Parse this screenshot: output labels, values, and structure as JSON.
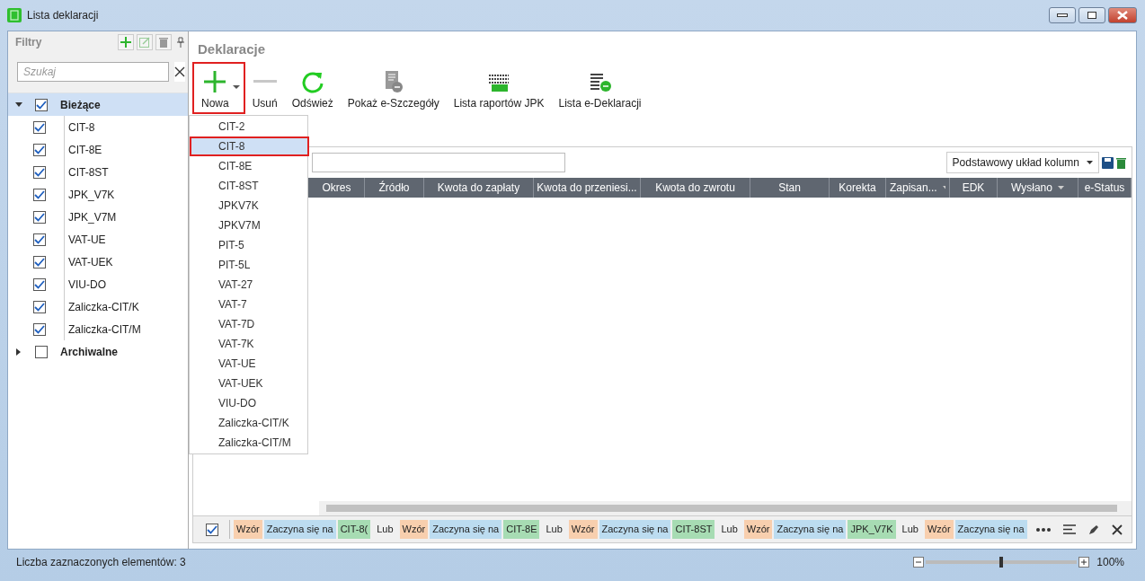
{
  "window": {
    "title": "Lista deklaracji"
  },
  "filters_panel": {
    "title": "Filtry",
    "search": {
      "placeholder": "Szukaj"
    },
    "groups": [
      {
        "label": "Bieżące",
        "checked": true,
        "expanded": true,
        "selected": true,
        "children": [
          {
            "label": "CIT-8",
            "checked": true
          },
          {
            "label": "CIT-8E",
            "checked": true
          },
          {
            "label": "CIT-8ST",
            "checked": true
          },
          {
            "label": "JPK_V7K",
            "checked": true
          },
          {
            "label": "JPK_V7M",
            "checked": true
          },
          {
            "label": "VAT-UE",
            "checked": true
          },
          {
            "label": "VAT-UEK",
            "checked": true
          },
          {
            "label": "VIU-DO",
            "checked": true
          },
          {
            "label": "Zaliczka-CIT/K",
            "checked": true
          },
          {
            "label": "Zaliczka-CIT/M",
            "checked": true
          }
        ]
      },
      {
        "label": "Archiwalne",
        "checked": false,
        "expanded": false,
        "selected": false
      }
    ]
  },
  "section_title": "Deklaracje",
  "toolbar": [
    {
      "label": "Nowa",
      "kind": "add",
      "highlighted": true
    },
    {
      "label": "Usuń",
      "kind": "remove",
      "highlighted": false
    },
    {
      "label": "Odśwież",
      "kind": "refresh",
      "highlighted": false
    },
    {
      "label": "Pokaż e-Szczegóły",
      "kind": "edoc",
      "highlighted": false
    },
    {
      "label": "Lista raportów JPK",
      "kind": "jpk",
      "highlighted": false
    },
    {
      "label": "Lista e-Deklaracji",
      "kind": "elist",
      "highlighted": false
    }
  ],
  "new_menu": [
    {
      "label": "CIT-2",
      "selected": false
    },
    {
      "label": "CIT-8",
      "selected": true
    },
    {
      "label": "CIT-8E",
      "selected": false
    },
    {
      "label": "CIT-8ST",
      "selected": false
    },
    {
      "label": "JPKV7K",
      "selected": false
    },
    {
      "label": "JPKV7M",
      "selected": false
    },
    {
      "label": "PIT-5",
      "selected": false
    },
    {
      "label": "PIT-5L",
      "selected": false
    },
    {
      "label": "VAT-27",
      "selected": false
    },
    {
      "label": "VAT-7",
      "selected": false
    },
    {
      "label": "VAT-7D",
      "selected": false
    },
    {
      "label": "VAT-7K",
      "selected": false
    },
    {
      "label": "VAT-UE",
      "selected": false
    },
    {
      "label": "VAT-UEK",
      "selected": false
    },
    {
      "label": "VIU-DO",
      "selected": false
    },
    {
      "label": "Zaliczka-CIT/K",
      "selected": false
    },
    {
      "label": "Zaliczka-CIT/M",
      "selected": false
    }
  ],
  "grid": {
    "layout_select": "Podstawowy układ kolumn",
    "columns": [
      {
        "label": "Okres",
        "filter": false
      },
      {
        "label": "Źródło",
        "filter": false
      },
      {
        "label": "Kwota do zapłaty",
        "filter": false
      },
      {
        "label": "Kwota do przeniesi...",
        "filter": false
      },
      {
        "label": "Kwota do zwrotu",
        "filter": false
      },
      {
        "label": "Stan",
        "filter": false
      },
      {
        "label": "Korekta",
        "filter": false
      },
      {
        "label": "Zapisan...",
        "filter": true
      },
      {
        "label": "EDK",
        "filter": false
      },
      {
        "label": "Wysłano",
        "filter": true
      },
      {
        "label": "e-Status",
        "filter": false
      }
    ]
  },
  "filter_bar": {
    "enabled": true,
    "tokens": [
      {
        "text": "Wzór",
        "kind": "field"
      },
      {
        "text": "Zaczyna się na",
        "kind": "operator"
      },
      {
        "text": "CIT-8(",
        "kind": "value"
      },
      {
        "text": "Lub",
        "kind": "join"
      },
      {
        "text": "Wzór",
        "kind": "field"
      },
      {
        "text": "Zaczyna się na",
        "kind": "operator"
      },
      {
        "text": "CIT-8E",
        "kind": "value"
      },
      {
        "text": "Lub",
        "kind": "join"
      },
      {
        "text": "Wzór",
        "kind": "field"
      },
      {
        "text": "Zaczyna się na",
        "kind": "operator"
      },
      {
        "text": "CIT-8ST",
        "kind": "value"
      },
      {
        "text": "Lub",
        "kind": "join"
      },
      {
        "text": "Wzór",
        "kind": "field"
      },
      {
        "text": "Zaczyna się na",
        "kind": "operator"
      },
      {
        "text": "JPK_V7K",
        "kind": "value"
      },
      {
        "text": "Lub",
        "kind": "join"
      },
      {
        "text": "Wzór",
        "kind": "field"
      },
      {
        "text": "Zaczyna się na",
        "kind": "operator"
      }
    ]
  },
  "status_bar": {
    "text": "Liczba zaznaczonych elementów: 3",
    "zoom": {
      "level": 0.5,
      "reading": "100%"
    }
  }
}
